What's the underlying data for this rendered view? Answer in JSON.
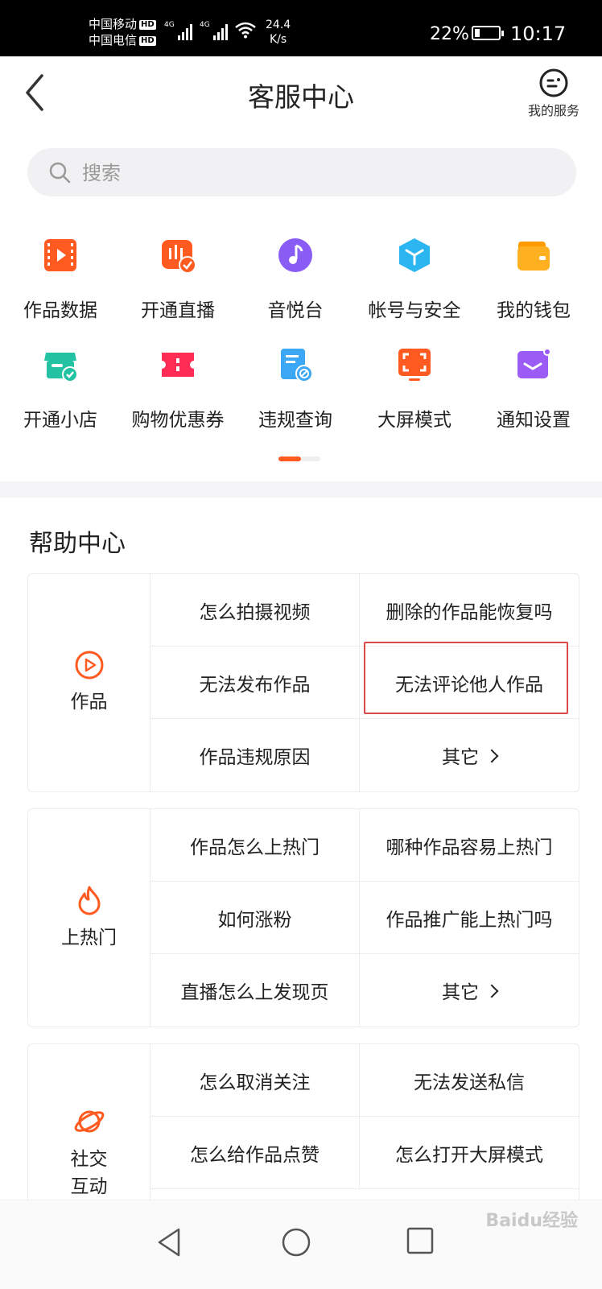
{
  "status_bar": {
    "carrier1": "中国移动",
    "carrier2": "中国电信",
    "hd": "HD",
    "net1": "4G",
    "net2": "4G",
    "speed_value": "24.4",
    "speed_unit": "K/s",
    "battery": "22%",
    "battery_level": 0.22,
    "time": "10:17"
  },
  "header": {
    "title": "客服中心",
    "my_service_label": "我的服务"
  },
  "search": {
    "placeholder": "搜索"
  },
  "quick_actions": [
    {
      "label": "作品数据",
      "icon": "video-data-icon",
      "color": "#ff5a1f"
    },
    {
      "label": "开通直播",
      "icon": "live-icon",
      "color": "#ff5a1f"
    },
    {
      "label": "音悦台",
      "icon": "music-icon",
      "color": "#8a5cf6"
    },
    {
      "label": "帐号与安全",
      "icon": "account-security-icon",
      "color": "#2bb6f2"
    },
    {
      "label": "我的钱包",
      "icon": "wallet-icon",
      "color": "#ffb020"
    },
    {
      "label": "开通小店",
      "icon": "shop-icon",
      "color": "#23c2a2"
    },
    {
      "label": "购物优惠券",
      "icon": "coupon-icon",
      "color": "#ff2d55"
    },
    {
      "label": "违规查询",
      "icon": "violation-query-icon",
      "color": "#3ba7f5"
    },
    {
      "label": "大屏模式",
      "icon": "big-screen-icon",
      "color": "#ff5a1f"
    },
    {
      "label": "通知设置",
      "icon": "notification-icon",
      "color": "#9b5cf6"
    }
  ],
  "pager": {
    "pages": 2,
    "active": 1
  },
  "help_center": {
    "title": "帮助中心",
    "categories": [
      {
        "label": "作品",
        "icon": "play-circle-icon",
        "items": [
          "怎么拍摄视频",
          "删除的作品能恢复吗",
          "无法发布作品",
          "无法评论他人作品",
          "作品违规原因",
          "其它"
        ]
      },
      {
        "label": "上热门",
        "icon": "flame-icon",
        "items": [
          "作品怎么上热门",
          "哪种作品容易上热门",
          "如何涨粉",
          "作品推广能上热门吗",
          "直播怎么上发现页",
          "其它"
        ]
      },
      {
        "label": "社交互动",
        "icon": "planet-icon",
        "items": [
          "怎么取消关注",
          "无法发送私信",
          "怎么给作品点赞",
          "怎么打开大屏模式"
        ]
      }
    ]
  },
  "accent_color": "#ff5a1f",
  "highlight_color": "#d94a4a",
  "watermark": "Baidu经验"
}
